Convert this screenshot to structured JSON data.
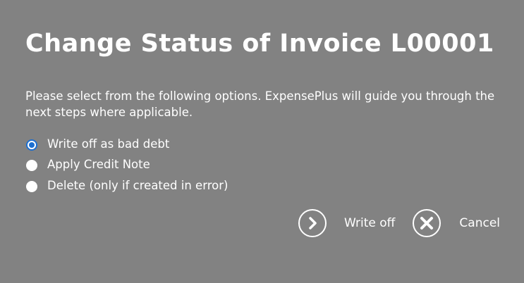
{
  "dialog": {
    "title": "Change Status of Invoice L00001",
    "description": "Please select from the following options. ExpensePlus will guide you through the next steps where applicable.",
    "options": [
      {
        "label": "Write off as bad debt",
        "selected": true
      },
      {
        "label": "Apply Credit Note",
        "selected": false
      },
      {
        "label": "Delete (only if created in error)",
        "selected": false
      }
    ],
    "actions": {
      "confirm_label": "Write off",
      "confirm_icon": "chevron-right-circle-icon",
      "cancel_label": "Cancel",
      "cancel_icon": "close-circle-icon"
    },
    "colors": {
      "background": "#828282",
      "text": "#ffffff",
      "radio_accent": "#1c6fd1"
    }
  }
}
